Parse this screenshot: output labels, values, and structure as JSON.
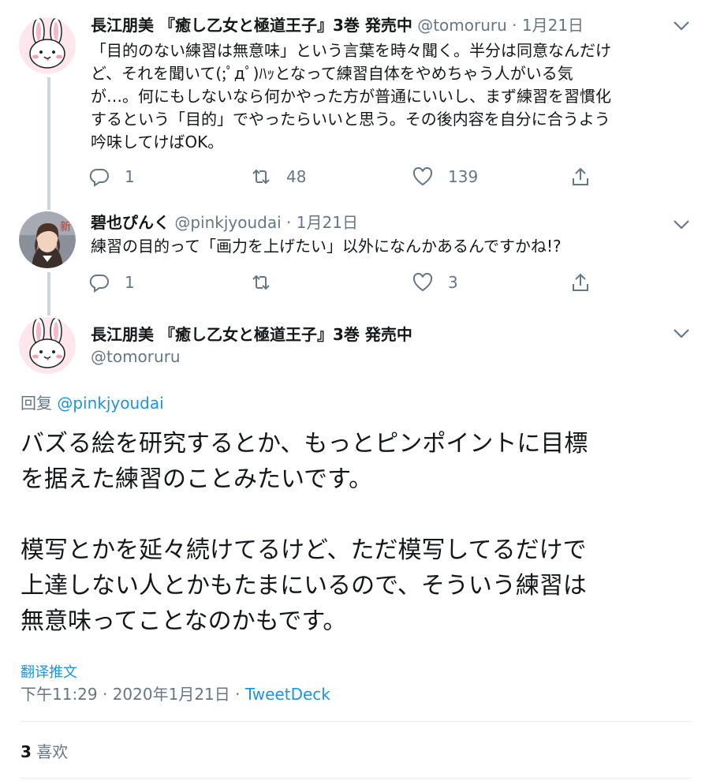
{
  "tweet1": {
    "name": "長江朋美 『癒し乙女と極道王子』3巻 発売中",
    "handle": "@tomoruru",
    "dot": "·",
    "date": "1月21日",
    "lines": [
      "「目的のない練習は無意味」という言葉を時々聞く。半分は同意なんだけ",
      "ど、それを聞いて(;ﾟдﾟ)ﾊｯとなって練習自体をやめちゃう人がいる気",
      "が…。何にもしないなら何かやった方が普通にいいし、まず練習を習慣化",
      "するという「目的」でやったらいいと思う。その後内容を自分に合うよう",
      "吟味してけばOK。"
    ],
    "reply_count": "1",
    "retweet_count": "48",
    "like_count": "139"
  },
  "tweet2": {
    "name": "碧也ぴんく",
    "handle": "@pinkjyoudai",
    "dot": "·",
    "date": "1月21日",
    "text": "練習の目的って「画力を上げたい」以外になんかあるんですかね!?",
    "reply_count": "1",
    "retweet_count": "",
    "like_count": "3"
  },
  "main_tweet": {
    "name": "長江朋美 『癒し乙女と極道王子』3巻 発売中",
    "handle": "@tomoruru",
    "reply_prefix": "回复",
    "reply_mention": "@pinkjyoudai",
    "paragraphs": [
      [
        "バズる絵を研究するとか、もっとピンポイントに目標",
        "を据えた練習のことみたいです。"
      ],
      [
        "模写とかを延々続けてるけど、ただ模写してるだけで",
        "上達しない人とかもたまにいるので、そういう練習は",
        "無意味ってことなのかもです。"
      ]
    ],
    "translate_label": "翻译推文",
    "timestamp": "下午11:29 · 2020年1月21日 · ",
    "source": "TweetDeck",
    "likes_count": "3",
    "likes_label": " 喜欢"
  },
  "icons": {
    "reply": "reply-icon",
    "retweet": "retweet-icon",
    "like": "heart-icon",
    "share": "share-icon",
    "caret": "chevron-down-icon"
  },
  "colors": {
    "secondary_text": "#657786",
    "link": "#1b95e0",
    "thread_line": "#ccd6dd"
  }
}
